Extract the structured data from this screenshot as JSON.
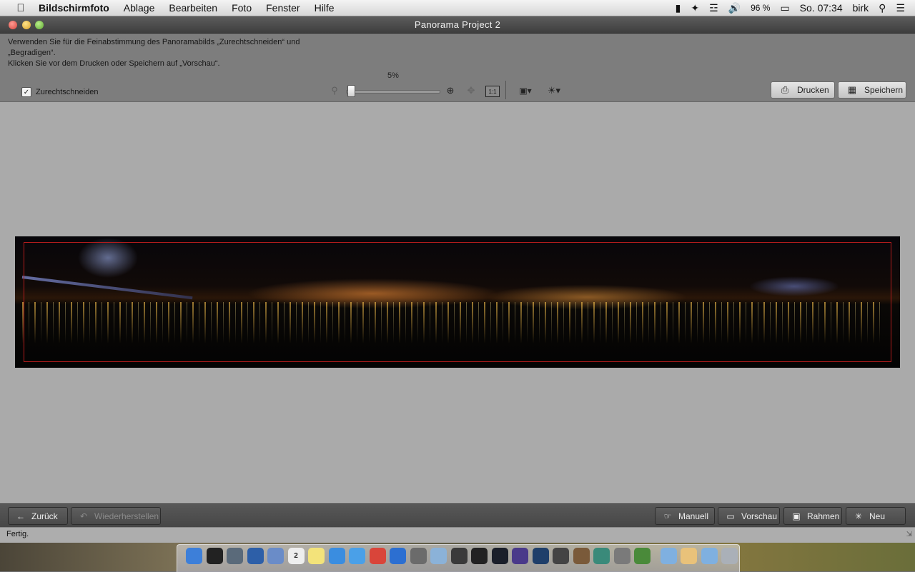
{
  "menubar": {
    "app_name": "Bildschirmfoto",
    "items": [
      "Ablage",
      "Bearbeiten",
      "Foto",
      "Fenster",
      "Hilfe"
    ],
    "battery": "96 %",
    "clock": "So. 07:34",
    "user": "birk"
  },
  "window": {
    "title": "Panorama Project 2"
  },
  "toolbar": {
    "instructions": [
      "Verwenden Sie für die Feinabstimmung des Panoramabilds „Zurechtschneiden“ und",
      "„Begradigen“.",
      "Klicken Sie vor dem Drucken oder Speichern auf „Vorschau“."
    ],
    "crop_label": "Zurechtschneiden",
    "crop_checked": true,
    "zoom_percent": "5%",
    "zoom_level": 0.05,
    "actual_size_label": "1:1",
    "print_label": "Drucken",
    "save_label": "Speichern"
  },
  "bottombar": {
    "back_label": "Zurück",
    "restore_label": "Wiederherstellen",
    "manual_label": "Manuell",
    "preview_label": "Vorschau",
    "frame_label": "Rahmen",
    "new_label": "Neu"
  },
  "status": {
    "text": "Fertig."
  },
  "dock": {
    "calendar_day": "2",
    "icons": [
      {
        "name": "finder-icon",
        "color": "#3d7fd9"
      },
      {
        "name": "terminal-icon",
        "color": "#222222"
      },
      {
        "name": "activity-monitor-icon",
        "color": "#5a6a7a"
      },
      {
        "name": "network-icon",
        "color": "#2d5fa8"
      },
      {
        "name": "mail-icon",
        "color": "#6a8cc8"
      },
      {
        "name": "calendar-icon",
        "color": "#eeeeee"
      },
      {
        "name": "notes-icon",
        "color": "#f3e37a"
      },
      {
        "name": "itunes-icon",
        "color": "#3a8de0"
      },
      {
        "name": "safari-icon",
        "color": "#4aa0e8"
      },
      {
        "name": "chrome-icon",
        "color": "#d9453a"
      },
      {
        "name": "word-icon",
        "color": "#2c6fd1"
      },
      {
        "name": "camera-icon",
        "color": "#6b6b6b"
      },
      {
        "name": "preview-icon",
        "color": "#8bb2d8"
      },
      {
        "name": "lens-icon",
        "color": "#3a3a3a"
      },
      {
        "name": "nikon-icon",
        "color": "#222222"
      },
      {
        "name": "lightroom-icon",
        "color": "#1a1f2a"
      },
      {
        "name": "aperture-icon",
        "color": "#4a3a8a"
      },
      {
        "name": "info-icon",
        "color": "#1f3f6a"
      },
      {
        "name": "photo-browser-icon",
        "color": "#444444"
      },
      {
        "name": "photo-stack-icon",
        "color": "#7a5a3a"
      },
      {
        "name": "iphoto-icon",
        "color": "#3a8a7a"
      },
      {
        "name": "x11-icon",
        "color": "#7a7a7a"
      },
      {
        "name": "disk-utility-icon",
        "color": "#4a8a3a"
      },
      {
        "name": "applications-folder-icon",
        "color": "#7fb0e0"
      },
      {
        "name": "home-folder-icon",
        "color": "#e9c27a"
      },
      {
        "name": "downloads-folder-icon",
        "color": "#7fb0e0"
      },
      {
        "name": "trash-icon",
        "color": "#aab0b8"
      }
    ]
  }
}
